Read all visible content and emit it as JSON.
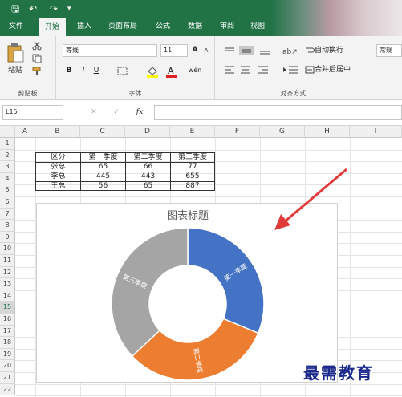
{
  "quick_access": {
    "save": "🖫",
    "undo": "↶",
    "redo": "↷",
    "more": "▾"
  },
  "tabs": [
    "文件",
    "开始",
    "插入",
    "页面布局",
    "公式",
    "数据",
    "审阅",
    "视图"
  ],
  "ribbon": {
    "clipboard": {
      "paste": "粘贴",
      "label": "剪贴板"
    },
    "font": {
      "name": "等线",
      "size": "11",
      "grow": "A",
      "shrink": "A",
      "bold": "B",
      "italic": "I",
      "underline": "U",
      "phonetic": "wén",
      "label": "字体"
    },
    "alignment": {
      "wrap": "自动换行",
      "merge": "合并后居中",
      "label": "对齐方式"
    },
    "number": {
      "format": "常规"
    }
  },
  "formula_bar": {
    "name_box": "L15",
    "cancel": "✕",
    "enter": "✓",
    "fx": "fx",
    "formula": ""
  },
  "columns": [
    "A",
    "B",
    "C",
    "D",
    "E",
    "F",
    "G",
    "H",
    "I"
  ],
  "rows": [
    "1",
    "2",
    "3",
    "4",
    "5",
    "6",
    "7",
    "8",
    "9",
    "10",
    "11",
    "12",
    "13",
    "14",
    "15",
    "16",
    "17",
    "18",
    "19",
    "20",
    "21",
    "22"
  ],
  "table": {
    "header": [
      "区分",
      "第一季度",
      "第二季度",
      "第三季度"
    ],
    "rows": [
      [
        "张总",
        "65",
        "66",
        "77"
      ],
      [
        "李总",
        "445",
        "443",
        "655"
      ],
      [
        "王总",
        "56",
        "65",
        "887"
      ]
    ]
  },
  "chart_data": {
    "type": "pie",
    "variant": "doughnut",
    "title": "图表标题",
    "categories": [
      "第一季度",
      "第二季度",
      "第三季度"
    ],
    "values": [
      65,
      66,
      77
    ],
    "colors": [
      "#4472c4",
      "#ed7d31",
      "#a5a5a5"
    ],
    "data_labels": [
      "第一季度",
      "第二季度",
      "第三季度"
    ]
  },
  "watermark": "最需教育",
  "colors": {
    "brand": "#217346",
    "arrow": "#e03a3a"
  }
}
